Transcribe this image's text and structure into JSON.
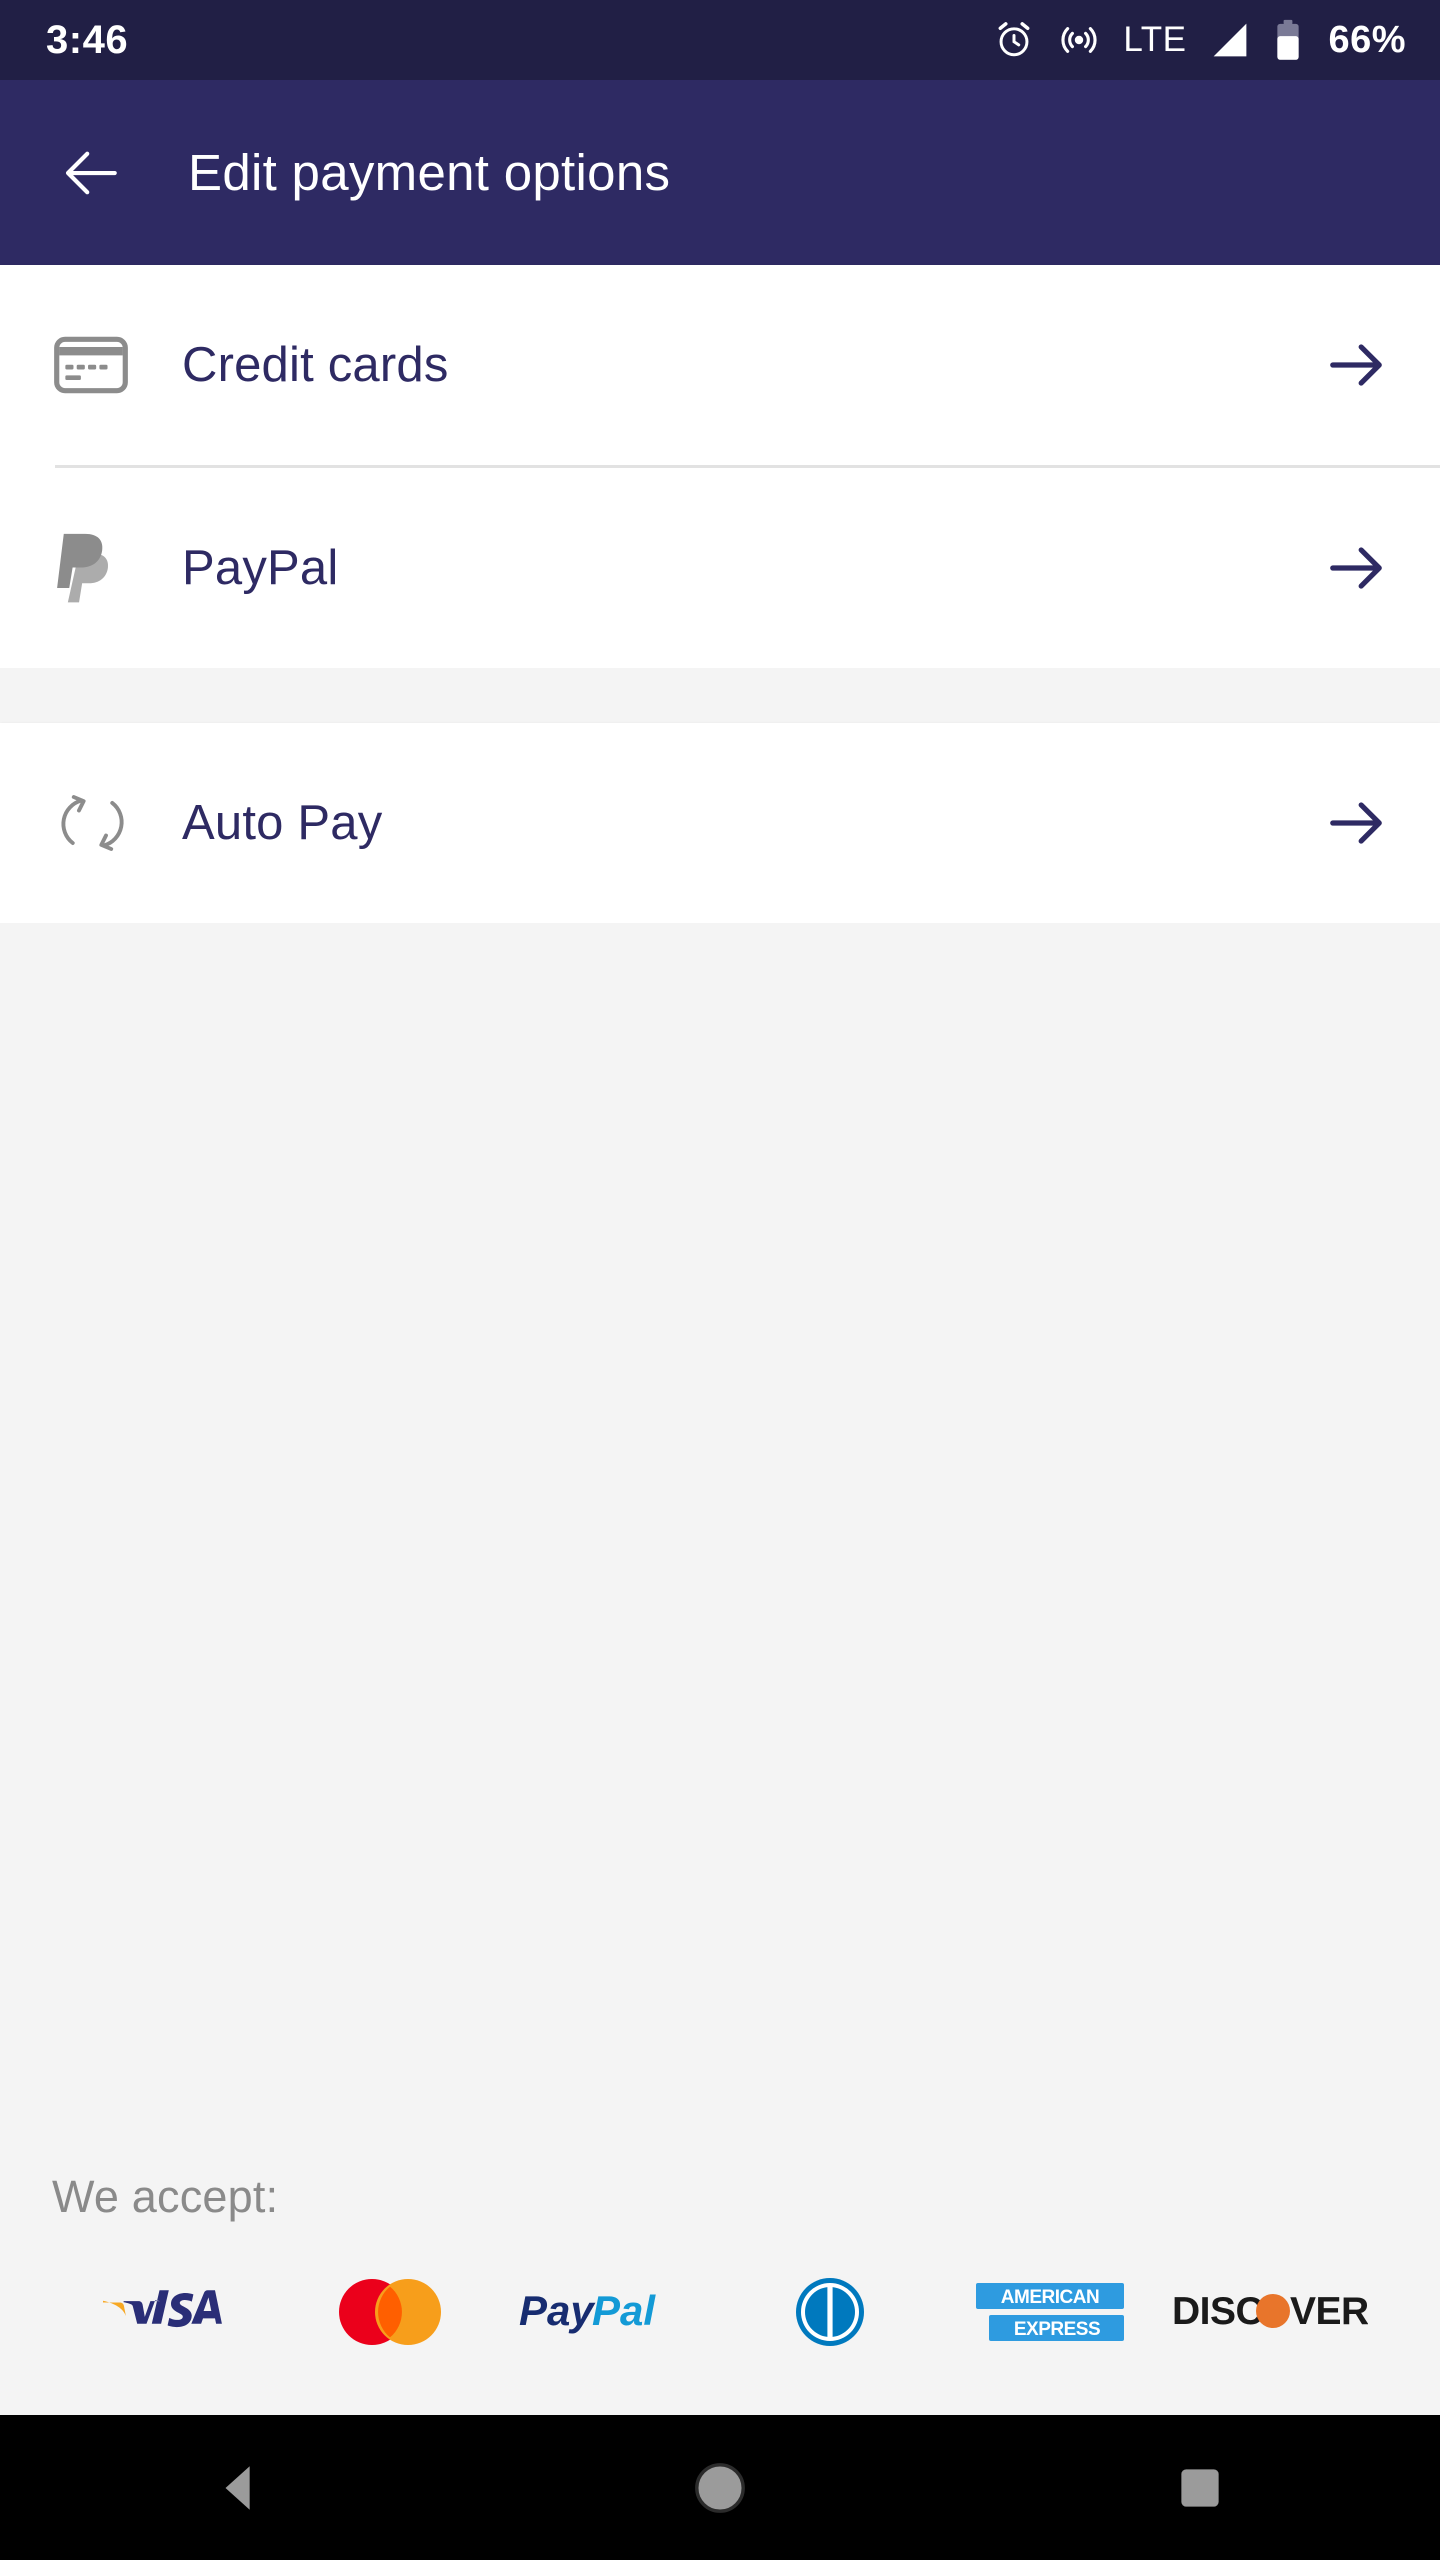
{
  "status_bar": {
    "clock": "3:46",
    "network_type": "LTE",
    "battery_percent": "66%",
    "icons": [
      "alarm-icon",
      "hotspot-icon",
      "signal-icon",
      "battery-icon"
    ],
    "background": "#211F45"
  },
  "app_bar": {
    "title": "Edit payment options",
    "back_icon": "arrow-left-icon",
    "background": "#2E2A63",
    "text_color": "#FFFFFF"
  },
  "menu": {
    "group_one": [
      {
        "label": "Credit cards",
        "icon": "credit-card-icon",
        "arrow": "arrow-right-icon"
      },
      {
        "label": "PayPal",
        "icon": "paypal-mark-icon",
        "arrow": "arrow-right-icon"
      }
    ],
    "group_two": [
      {
        "label": "Auto Pay",
        "icon": "sync-icon",
        "arrow": "arrow-right-icon"
      }
    ],
    "row_text_color": "#2E2A63",
    "icon_color": "#8C8C8C",
    "divider_color": "#E2E2E2"
  },
  "accepted": {
    "title": "We accept:",
    "title_color": "#8A8A8A",
    "logos": [
      {
        "name": "visa-logo",
        "text": "VISA",
        "color": "#2A2E77",
        "accent": "#F7A823"
      },
      {
        "name": "mastercard-logo",
        "text": "Mastercard",
        "color": "#EB001B",
        "accent": "#F79E1B"
      },
      {
        "name": "paypal-logo",
        "text": "PayPal",
        "color": "#172C70",
        "accent": "#139AD6"
      },
      {
        "name": "diners-club-logo",
        "text": "Diners Club",
        "color": "#0079BE",
        "accent": "#FFFFFF"
      },
      {
        "name": "american-express-logo",
        "text": "AMERICAN EXPRESS",
        "color": "#2E9BE0",
        "accent": "#FFFFFF"
      },
      {
        "name": "discover-logo",
        "text": "DISCOVER",
        "color": "#1A1A1A",
        "accent": "#E8752B"
      }
    ]
  },
  "nav_bar": {
    "back": "nav-back-icon",
    "home": "nav-home-icon",
    "recents": "nav-recents-icon",
    "background": "#000000",
    "icon_color": "#9B9B9B"
  }
}
